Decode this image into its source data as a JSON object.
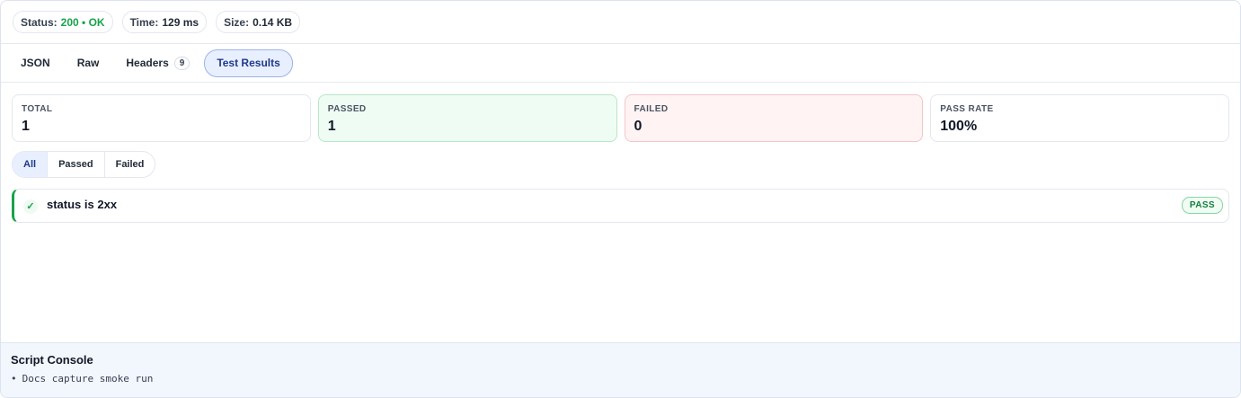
{
  "status": {
    "status_label": "Status:",
    "status_value": "200 • OK",
    "time_label": "Time:",
    "time_value": "129 ms",
    "size_label": "Size:",
    "size_value": "0.14 KB"
  },
  "tabs": [
    {
      "label": "JSON"
    },
    {
      "label": "Raw"
    },
    {
      "label": "Headers",
      "count": "9"
    },
    {
      "label": "Test Results",
      "active": true
    }
  ],
  "summary": {
    "total_label": "TOTAL",
    "total_value": "1",
    "passed_label": "PASSED",
    "passed_value": "1",
    "failed_label": "FAILED",
    "failed_value": "0",
    "rate_label": "PASS RATE",
    "rate_value": "100%"
  },
  "filters": [
    {
      "label": "All",
      "active": true
    },
    {
      "label": "Passed"
    },
    {
      "label": "Failed"
    }
  ],
  "results": [
    {
      "name": "status is 2xx",
      "badge": "PASS",
      "icon": "check-icon"
    }
  ],
  "console": {
    "title": "Script Console",
    "lines": [
      "Docs capture smoke run"
    ]
  },
  "colors": {
    "accent": "#1e3a8a",
    "pass": "#16a34a",
    "fail_bg": "#fff3f4",
    "pass_bg": "#effcf4"
  }
}
